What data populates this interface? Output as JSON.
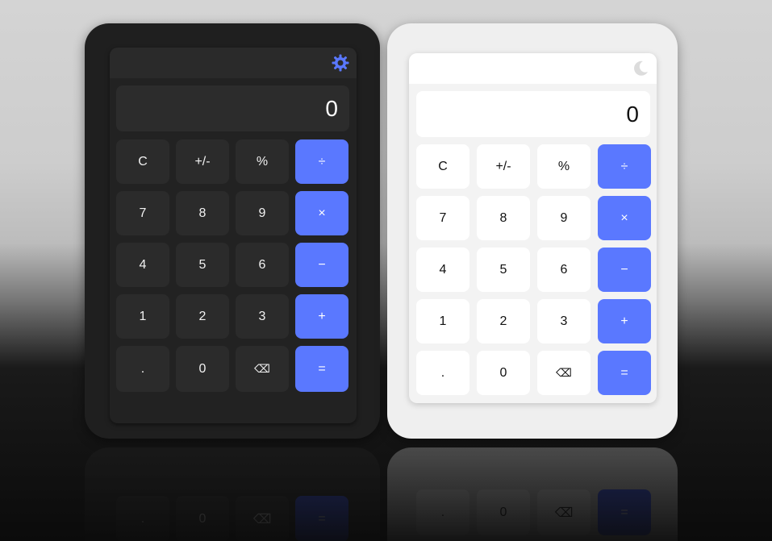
{
  "dark_calculator": {
    "display_value": "0",
    "theme_toggle_icon": "gear-icon",
    "accent_color": "#5a78ff",
    "keys": [
      {
        "label": "C",
        "type": "function",
        "name": "clear-button"
      },
      {
        "label": "+/-",
        "type": "function",
        "name": "sign-toggle-button"
      },
      {
        "label": "%",
        "type": "function",
        "name": "percent-button"
      },
      {
        "label": "÷",
        "type": "operator",
        "name": "divide-button"
      },
      {
        "label": "7",
        "type": "digit",
        "name": "digit-7-button"
      },
      {
        "label": "8",
        "type": "digit",
        "name": "digit-8-button"
      },
      {
        "label": "9",
        "type": "digit",
        "name": "digit-9-button"
      },
      {
        "label": "×",
        "type": "operator",
        "name": "multiply-button"
      },
      {
        "label": "4",
        "type": "digit",
        "name": "digit-4-button"
      },
      {
        "label": "5",
        "type": "digit",
        "name": "digit-5-button"
      },
      {
        "label": "6",
        "type": "digit",
        "name": "digit-6-button"
      },
      {
        "label": "−",
        "type": "operator",
        "name": "subtract-button"
      },
      {
        "label": "1",
        "type": "digit",
        "name": "digit-1-button"
      },
      {
        "label": "2",
        "type": "digit",
        "name": "digit-2-button"
      },
      {
        "label": "3",
        "type": "digit",
        "name": "digit-3-button"
      },
      {
        "label": "+",
        "type": "operator",
        "name": "add-button"
      },
      {
        "label": ".",
        "type": "digit",
        "name": "decimal-button"
      },
      {
        "label": "0",
        "type": "digit",
        "name": "digit-0-button"
      },
      {
        "label": "⌫",
        "type": "function",
        "name": "backspace-button"
      },
      {
        "label": "=",
        "type": "operator",
        "name": "equals-button"
      }
    ]
  },
  "light_calculator": {
    "display_value": "0",
    "theme_toggle_icon": "moon-icon",
    "accent_color": "#5a78ff",
    "keys": [
      {
        "label": "C",
        "type": "function",
        "name": "clear-button"
      },
      {
        "label": "+/-",
        "type": "function",
        "name": "sign-toggle-button"
      },
      {
        "label": "%",
        "type": "function",
        "name": "percent-button"
      },
      {
        "label": "÷",
        "type": "operator",
        "name": "divide-button"
      },
      {
        "label": "7",
        "type": "digit",
        "name": "digit-7-button"
      },
      {
        "label": "8",
        "type": "digit",
        "name": "digit-8-button"
      },
      {
        "label": "9",
        "type": "digit",
        "name": "digit-9-button"
      },
      {
        "label": "×",
        "type": "operator",
        "name": "multiply-button"
      },
      {
        "label": "4",
        "type": "digit",
        "name": "digit-4-button"
      },
      {
        "label": "5",
        "type": "digit",
        "name": "digit-5-button"
      },
      {
        "label": "6",
        "type": "digit",
        "name": "digit-6-button"
      },
      {
        "label": "−",
        "type": "operator",
        "name": "subtract-button"
      },
      {
        "label": "1",
        "type": "digit",
        "name": "digit-1-button"
      },
      {
        "label": "2",
        "type": "digit",
        "name": "digit-2-button"
      },
      {
        "label": "3",
        "type": "digit",
        "name": "digit-3-button"
      },
      {
        "label": "+",
        "type": "operator",
        "name": "add-button"
      },
      {
        "label": ".",
        "type": "digit",
        "name": "decimal-button"
      },
      {
        "label": "0",
        "type": "digit",
        "name": "digit-0-button"
      },
      {
        "label": "⌫",
        "type": "function",
        "name": "backspace-button"
      },
      {
        "label": "=",
        "type": "operator",
        "name": "equals-button"
      }
    ]
  }
}
